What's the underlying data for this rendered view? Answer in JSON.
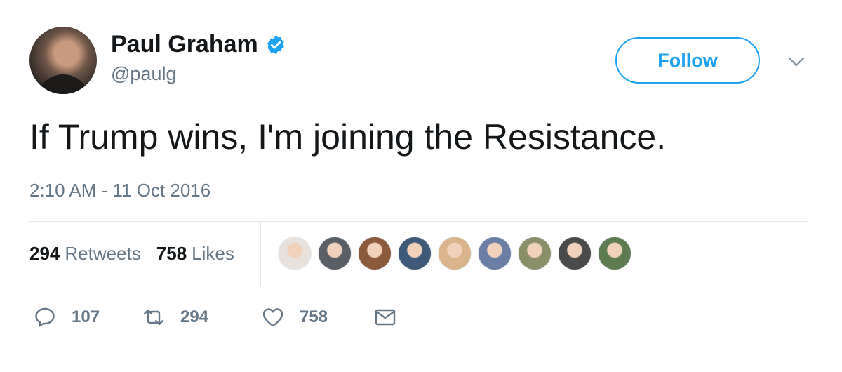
{
  "user": {
    "name": "Paul Graham",
    "handle": "@paulg",
    "verified": true
  },
  "follow_label": "Follow",
  "tweet": {
    "text": "If Trump wins, I'm joining the Resistance.",
    "timestamp": "2:10 AM - 11 Oct 2016"
  },
  "stats": {
    "retweets_count": "294",
    "retweets_label": "Retweets",
    "likes_count": "758",
    "likes_label": "Likes"
  },
  "liker_avatars": [
    {
      "name": "liker-avatar-1",
      "color": "#e9e2dc"
    },
    {
      "name": "liker-avatar-2",
      "color": "#5a5f66"
    },
    {
      "name": "liker-avatar-3",
      "color": "#8b5a3c"
    },
    {
      "name": "liker-avatar-4",
      "color": "#3e5a78"
    },
    {
      "name": "liker-avatar-5",
      "color": "#d9b48c"
    },
    {
      "name": "liker-avatar-6",
      "color": "#6b7ea3"
    },
    {
      "name": "liker-avatar-7",
      "color": "#8a8f6a"
    },
    {
      "name": "liker-avatar-8",
      "color": "#4a4a4a"
    },
    {
      "name": "liker-avatar-9",
      "color": "#5e7c52"
    }
  ],
  "actions": {
    "replies": "107",
    "retweets": "294",
    "likes": "758"
  },
  "colors": {
    "accent": "#1da1f2",
    "text": "#14171a",
    "muted": "#657786",
    "border": "#e1e8ed"
  },
  "icons": [
    "verified-badge-icon",
    "chevron-down-icon",
    "reply-icon",
    "retweet-icon",
    "like-icon",
    "direct-message-icon"
  ]
}
